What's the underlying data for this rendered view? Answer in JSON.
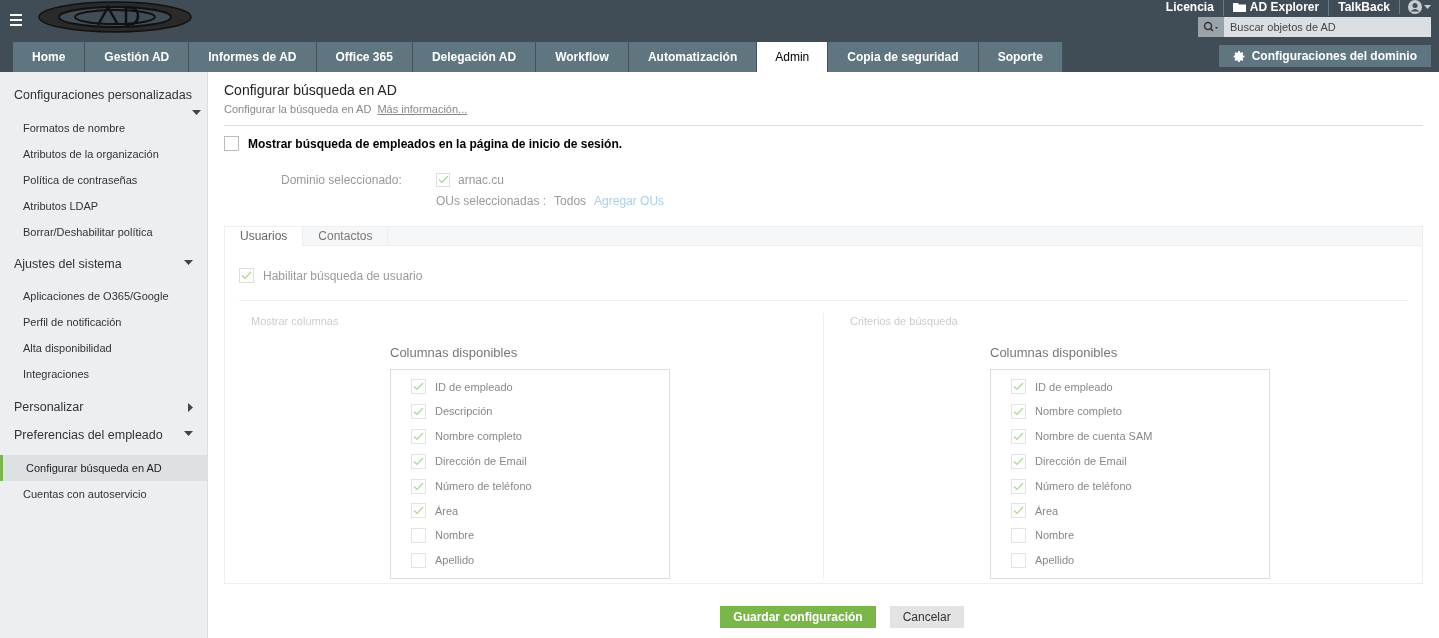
{
  "top_links": [
    {
      "label": "Licencia",
      "kind": "text"
    },
    {
      "label": "AD Explorer",
      "kind": "folder"
    },
    {
      "label": "TalkBack",
      "kind": "text"
    }
  ],
  "search": {
    "placeholder": "Buscar objetos de AD"
  },
  "tabs": [
    {
      "label": "Home",
      "selected": false
    },
    {
      "label": "Gestión AD",
      "selected": false
    },
    {
      "label": "Informes de AD",
      "selected": false
    },
    {
      "label": "Office 365",
      "selected": false
    },
    {
      "label": "Delegación AD",
      "selected": false
    },
    {
      "label": "Workflow",
      "selected": false
    },
    {
      "label": "Automatización",
      "selected": false
    },
    {
      "label": "Admin",
      "selected": true
    },
    {
      "label": "Copia de seguridad",
      "selected": false
    },
    {
      "label": "Soporte",
      "selected": false
    }
  ],
  "domain_button": "Configuraciones del dominio",
  "sidebar": [
    {
      "label": "Configuraciones personalizadas",
      "expanded": true,
      "children": [
        {
          "label": "Formatos de nombre",
          "selected": false
        },
        {
          "label": "Atributos de la organización",
          "selected": false
        },
        {
          "label": "Política de contraseñas",
          "selected": false
        },
        {
          "label": "Atributos LDAP",
          "selected": false
        },
        {
          "label": "Borrar/Deshabilitar política",
          "selected": false
        }
      ]
    },
    {
      "label": "Ajustes del sistema",
      "expanded": true,
      "children": [
        {
          "label": "Aplicaciones de O365/Google",
          "selected": false
        },
        {
          "label": "Perfil de notificación",
          "selected": false
        },
        {
          "label": "Alta disponibilidad",
          "selected": false
        },
        {
          "label": "Integraciones",
          "selected": false
        }
      ]
    },
    {
      "label": "Personalizar",
      "expanded": false
    },
    {
      "label": "Preferencias del empleado",
      "expanded": true,
      "children": [
        {
          "label": "Configurar búsqueda en AD",
          "selected": true
        },
        {
          "label": "Cuentas con autoservicio",
          "selected": false
        }
      ]
    }
  ],
  "page": {
    "title": "Configurar búsqueda en AD",
    "subtitle": "Configurar la búsqueda en AD",
    "more_link": "Más información..."
  },
  "show_search": {
    "label": "Mostrar búsqueda de empleados en la página de inicio de sesión.",
    "checked": false
  },
  "domain": {
    "label": "Dominio seleccionado:",
    "name": "arnac.cu",
    "checked": true,
    "ous_label": "OUs seleccionadas :",
    "ous_value": "Todos",
    "add_ous": "Agregar OUs"
  },
  "inner_tabs": [
    {
      "label": "Usuarios",
      "selected": true
    },
    {
      "label": "Contactos",
      "selected": false
    }
  ],
  "enable_user_search": {
    "label": "Habilitar búsqueda de usuario",
    "checked": true
  },
  "panels": [
    {
      "title": "Mostrar columnas",
      "heading": "Columnas disponibles",
      "items": [
        {
          "label": "ID de empleado",
          "checked": true
        },
        {
          "label": "Descripción",
          "checked": true
        },
        {
          "label": "Nombre completo",
          "checked": true
        },
        {
          "label": "Dirección de Email",
          "checked": true
        },
        {
          "label": "Número de teléfono",
          "checked": true
        },
        {
          "label": "Área",
          "checked": true
        },
        {
          "label": "Nombre",
          "checked": false
        },
        {
          "label": "Apellido",
          "checked": false
        }
      ]
    },
    {
      "title": "Criterios de búsqueda",
      "heading": "Columnas disponibles",
      "items": [
        {
          "label": "ID de empleado",
          "checked": true
        },
        {
          "label": "Nombre completo",
          "checked": true
        },
        {
          "label": "Nombre de cuenta SAM",
          "checked": true
        },
        {
          "label": "Dirección de Email",
          "checked": true
        },
        {
          "label": "Número de teléfono",
          "checked": true
        },
        {
          "label": "Área",
          "checked": true
        },
        {
          "label": "Nombre",
          "checked": false
        },
        {
          "label": "Apellido",
          "checked": false
        }
      ]
    }
  ],
  "buttons": {
    "save": "Guardar configuración",
    "cancel": "Cancelar"
  }
}
